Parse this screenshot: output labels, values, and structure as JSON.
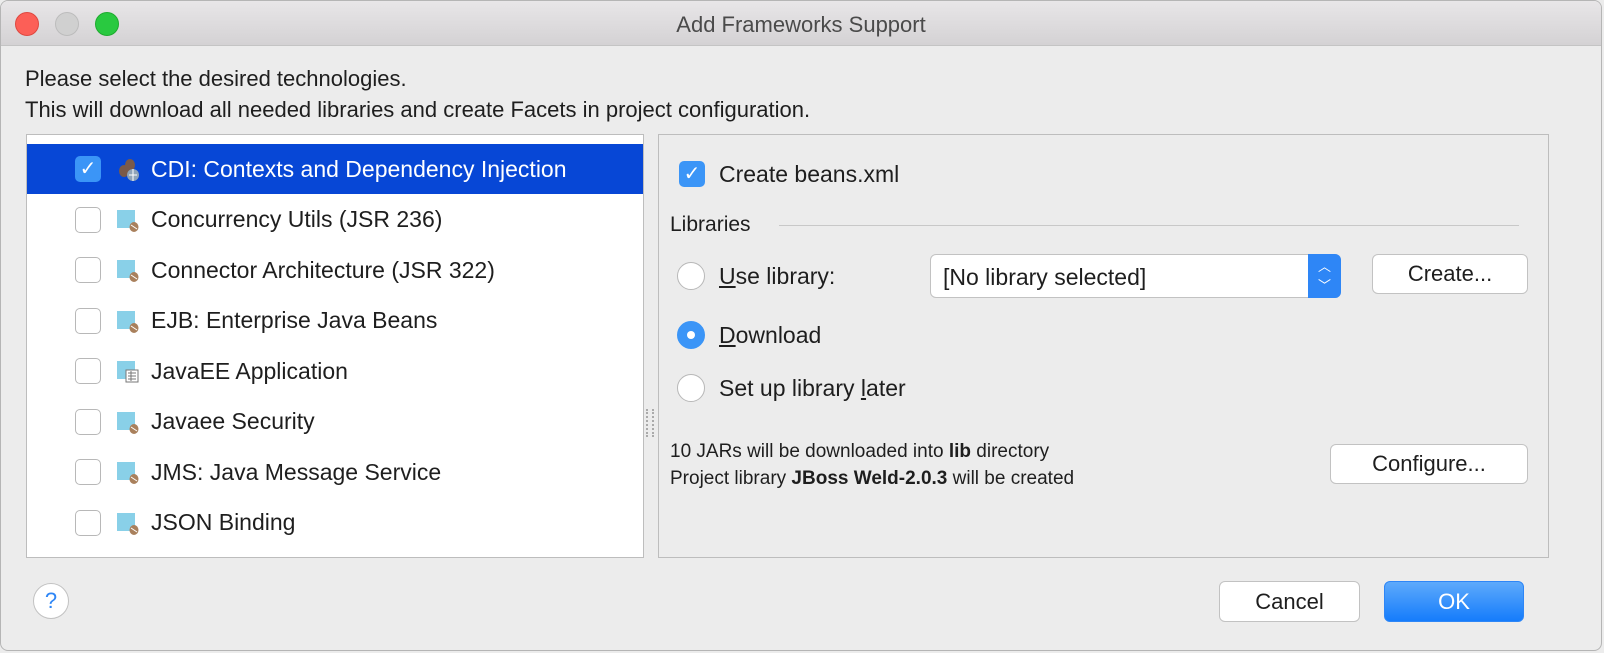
{
  "window": {
    "title": "Add Frameworks Support"
  },
  "intro": {
    "line1": "Please select the desired technologies.",
    "line2": "This will download all needed libraries and create Facets in project configuration."
  },
  "frameworks": [
    {
      "label": "CDI: Contexts and Dependency Injection",
      "checked": true,
      "selected": true,
      "icon": "cdi-beans-icon"
    },
    {
      "label": "Concurrency Utils (JSR 236)",
      "checked": false,
      "icon": "javaee-module-icon"
    },
    {
      "label": "Connector Architecture (JSR 322)",
      "checked": false,
      "icon": "javaee-module-icon"
    },
    {
      "label": "EJB: Enterprise Java Beans",
      "checked": false,
      "icon": "javaee-module-icon"
    },
    {
      "label": "JavaEE Application",
      "checked": false,
      "icon": "javaee-app-icon"
    },
    {
      "label": "Javaee Security",
      "checked": false,
      "icon": "javaee-module-icon"
    },
    {
      "label": "JMS: Java Message Service",
      "checked": false,
      "icon": "javaee-module-icon"
    },
    {
      "label": "JSON Binding",
      "checked": false,
      "icon": "javaee-module-icon"
    }
  ],
  "panel": {
    "create_beans": "Create beans.xml",
    "libraries_label": "Libraries",
    "use_library": {
      "mn": "U",
      "rest": "se library:"
    },
    "library_select": "[No library selected]",
    "create_button": "Create...",
    "download": {
      "mn": "D",
      "rest": "ownload"
    },
    "setup_later": {
      "pre": "Set up library ",
      "mn": "l",
      "rest": "ater"
    },
    "info1": {
      "a": "10 JARs will be downloaded into ",
      "b": "lib",
      "c": " directory"
    },
    "info2": {
      "a": "Project library ",
      "b": "JBoss Weld-2.0.3",
      "c": " will be created"
    },
    "configure_button": "Configure..."
  },
  "footer": {
    "help": "?",
    "cancel": "Cancel",
    "ok": "OK"
  },
  "colors": {
    "selection": "#0747d6",
    "accent": "#3b95f7"
  }
}
